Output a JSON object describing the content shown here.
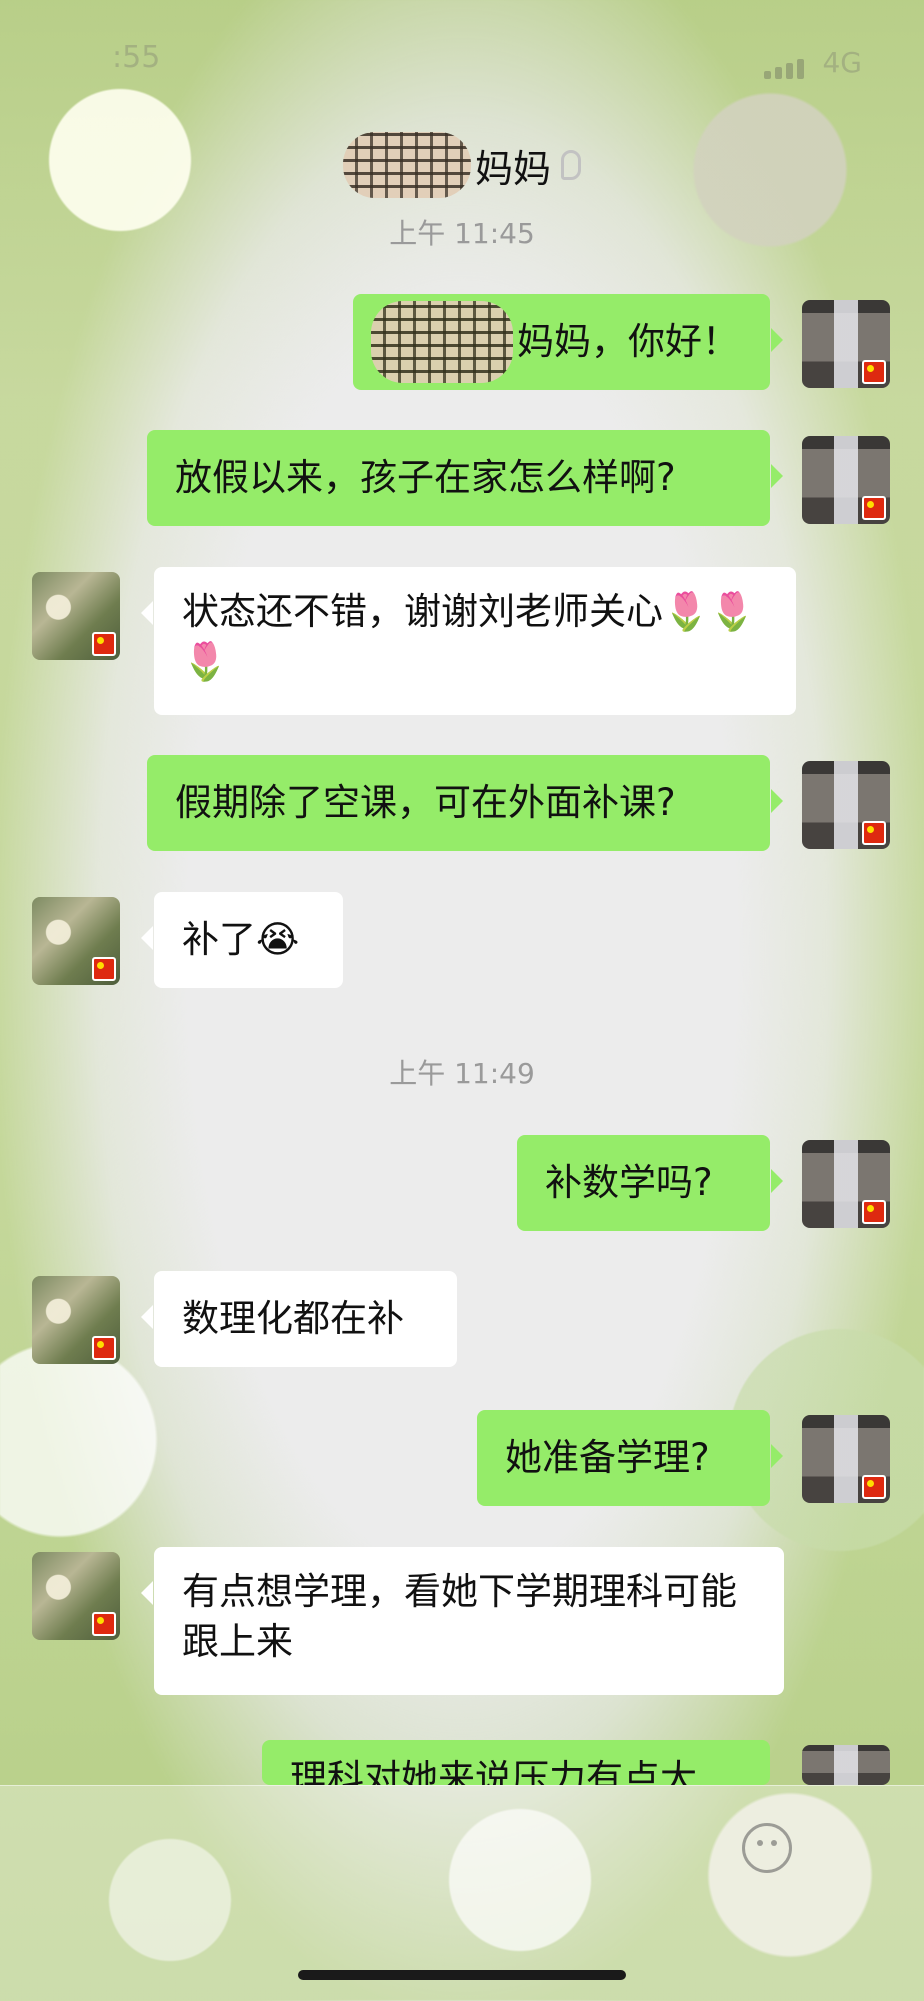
{
  "status_bar": {
    "time": ":55",
    "network": "4G"
  },
  "header": {
    "title": "妈妈"
  },
  "messages": {
    "ts1": "上午 11:45",
    "m1": "妈妈，你好！",
    "m2": "放假以来，孩子在家怎么样啊?",
    "m3": "状态还不错，谢谢刘老师关心🌷🌷🌷",
    "m4": "假期除了空课，可在外面补课?",
    "m5": "补了😭",
    "ts2": "上午 11:49",
    "m6": "补数学吗?",
    "m7": "数理化都在补",
    "m8": "她准备学理?",
    "m9": "有点想学理，看她下学期理科可能跟上来",
    "m10": "理科对她来说压力有点大"
  },
  "icons": {
    "emoji": "smiley-face-icon",
    "voice_mode": "ear-icon",
    "badge": "china-flag-icon"
  }
}
